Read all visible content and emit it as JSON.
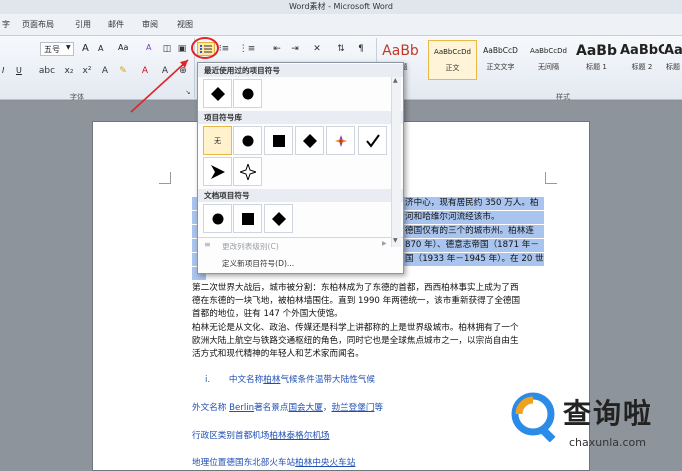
{
  "window": {
    "title": "Word素材 - Microsoft Word",
    "left_char": "字"
  },
  "menu": {
    "tabs": [
      "页面布局",
      "引用",
      "邮件",
      "审阅",
      "视图"
    ]
  },
  "ribbon": {
    "font_size": "五号",
    "grow_font": "A",
    "shrink_font": "A",
    "change_case": "Aa",
    "clear_format": "A",
    "font_group_label": "字体",
    "styles_group_label": "样式",
    "styles": [
      {
        "sample": "AaBb",
        "name": "标题"
      },
      {
        "sample": "AaBbCcDd",
        "name": "正文"
      },
      {
        "sample": "AaBbCcD",
        "name": "正文文字"
      },
      {
        "sample": "AaBbCcDd",
        "name": "无间隔"
      },
      {
        "sample": "AaBb",
        "name": "标题 1"
      },
      {
        "sample": "AaBbC",
        "name": "标题 2"
      },
      {
        "sample": "AaB",
        "name": "标题"
      }
    ]
  },
  "dropdown": {
    "recent_header": "最近使用过的项目符号",
    "library_header": "项目符号库",
    "none_label": "无",
    "document_header": "文档项目符号",
    "change_level": "更改列表级别(C)",
    "define_new": "定义新项目符号(D)..."
  },
  "document": {
    "lines_highlighted": [
      {
        "visible": "济中心，现有居民约 350 万人。柏"
      },
      {
        "visible": "河和哈维尔河流经该市。"
      },
      {
        "visible": "德国仅有的三个的城市州。柏林连"
      },
      {
        "visible": "870 年）、德意志帝国（1871 年－"
      },
      {
        "visible": "国（1933 年－1945 年）。在 20 世"
      }
    ],
    "paragraphs": [
      "第二次世界大战后，城市被分割：东柏林成为了东德的首都，西西柏林事实上成为了西",
      "德在东德的一块飞地，被柏林墙围住。直到 1990 年两德统一，该市重新获得了全德国",
      "首都的地位，驻有 147 个外国大使馆。",
      "柏林无论是从文化、政治、传媒还是科学上讲都称的上是世界级城市。柏林拥有了一个",
      "欧洲大陆上航空与铁路交通枢纽的角色，同时它也是全球焦点城市之一，以宗尚自由生",
      "活方式和现代精神的年轻人和艺术家而闻名。"
    ],
    "list_item": {
      "number": "i.",
      "text_prefix": "中文名称",
      "link": "柏林",
      "text_suffix": "气候条件温带大陆性气候"
    },
    "foreign_name": {
      "prefix": "外文名称 ",
      "link1": "Berlin",
      "mid": "著名景点",
      "link2": "国会大厦",
      "sep": "，",
      "link3": "勃兰登堡门",
      "suffix": "等"
    },
    "admin": {
      "prefix": "行政区类别首都机场",
      "link": "柏林泰格尔机场"
    },
    "geo": {
      "prefix": "地理位置德国东北部火车站",
      "link": "柏林中央火车站"
    }
  },
  "watermark": {
    "text": "查询啦",
    "sub": "chaxunla.com"
  },
  "colors": {
    "accent_red": "#e1232b",
    "highlight": "#a9c4ee",
    "link_blue": "#1f4fb5",
    "selection_gold": "#e8b947"
  }
}
